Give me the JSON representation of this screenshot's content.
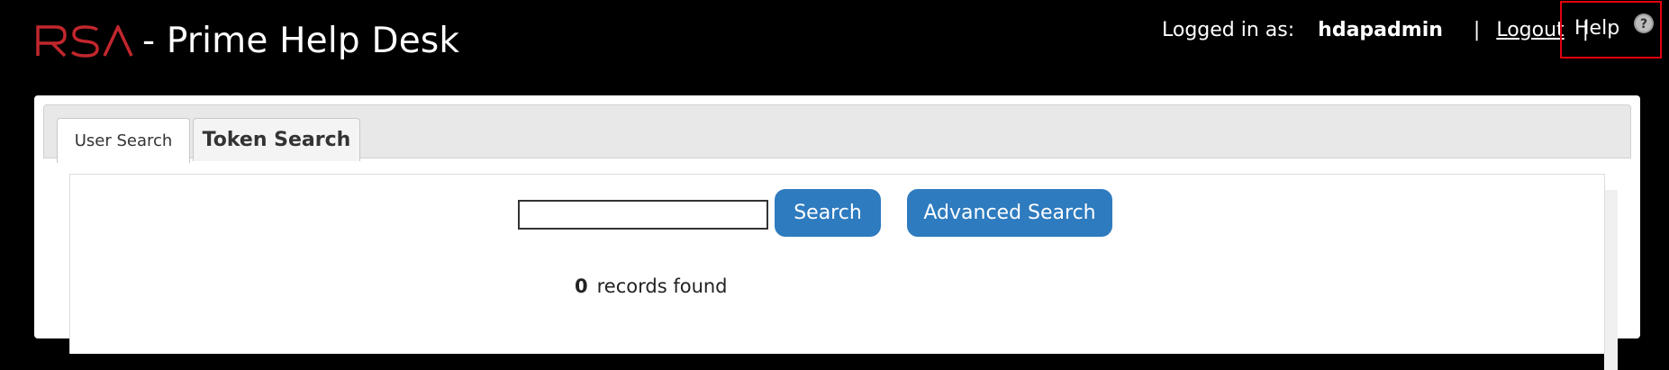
{
  "header": {
    "logo_text": "RSA",
    "app_title": "- Prime Help Desk",
    "logged_in_label": "Logged in as:",
    "username": "hdapadmin",
    "separator": "|",
    "logout_label": "Logout",
    "help_label": "Help"
  },
  "tabs": [
    {
      "label": "User Search",
      "active": true
    },
    {
      "label": "Token Search",
      "active": false
    }
  ],
  "search": {
    "input_value": "",
    "search_button_label": "Search",
    "advanced_button_label": "Advanced Search"
  },
  "results": {
    "count": "0",
    "label": "records found"
  },
  "colors": {
    "header_bg": "#000000",
    "logo_red": "#c1272d",
    "button_blue": "#2e7bbf",
    "highlight_red": "#e3000f"
  }
}
